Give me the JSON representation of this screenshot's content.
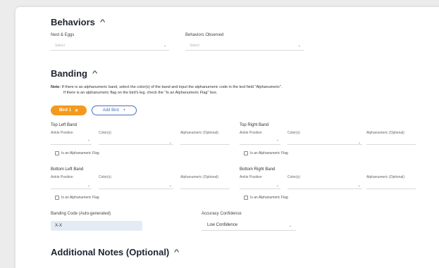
{
  "behaviors": {
    "title": "Behaviors",
    "nest_eggs_label": "Nest & Eggs",
    "nest_eggs_placeholder": "Select",
    "observed_label": "Behaviors Observed",
    "observed_placeholder": "Select"
  },
  "banding": {
    "title": "Banding",
    "note_prefix": "Note:",
    "note_line1": "If there is an alphanumeric band, select the color(s) of the band and input the alphanumeric code in the text field \"Alphanumeric\".",
    "note_line2": "If there is an alphanumeric flag on the bird's leg, check the \"Is an Alphanumeric Flag\" box.",
    "active_tab": "Bird 1",
    "add_bird": "Add Bird",
    "positions": {
      "top_left": "Top Left Band",
      "top_right": "Top Right Band",
      "bottom_left": "Bottom Left Band",
      "bottom_right": "Bottom Right Band"
    },
    "ankle_label": "Ankle Position",
    "color_label": "Color(s)",
    "alnum_label": "Alphanumeric (Optional)",
    "flag_label": "Is an Alphanumeric Flag",
    "code_label": "Banding Code (Auto-generated)",
    "code_value": "X-X",
    "confidence_label": "Accuracy Confidence",
    "confidence_value": "Low Confidence"
  },
  "notes": {
    "title": "Additional Notes (Optional)"
  },
  "icons": {
    "section_toggle": "chevron-up-icon",
    "dropdown": "chevron-down-icon",
    "remove": "close-icon",
    "add": "plus-icon"
  },
  "colors": {
    "accent": "#f39a1e",
    "link_blue": "#4a6fb5",
    "code_bg": "#e4ebf5"
  }
}
